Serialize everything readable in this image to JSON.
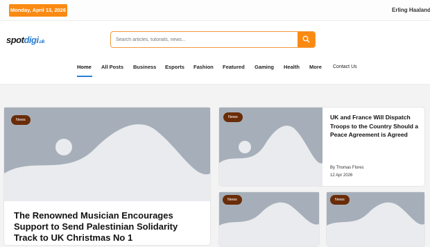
{
  "topbar": {
    "date": "Monday, April 13, 2026",
    "ticker": "Erling Haaland In"
  },
  "header": {
    "logo_part1": "spot",
    "logo_part2": "digi",
    "logo_part3": ".uk",
    "search_placeholder": "Search articles, tutorials, news...",
    "search_icon": "search-icon"
  },
  "nav": {
    "items": [
      "Home",
      "All Posts",
      "Business",
      "Esports",
      "Fashion",
      "Featured",
      "Gaming",
      "Health",
      "More",
      "Contact Us"
    ],
    "active": "Home"
  },
  "featured": {
    "tag": "News",
    "title": "The Renowned Musician Encourages Support to Send Palestinian Solidarity Track to UK Christmas No 1"
  },
  "side_article": {
    "tag": "News",
    "title": "UK and France Will Dispatch Troops to the Country Should a Peace Agreement is Agreed",
    "author": "By Thomas Flores",
    "date": "12 Apr 2026"
  },
  "small_cards": [
    {
      "tag": "News"
    },
    {
      "tag": "News"
    }
  ],
  "colors": {
    "accent": "#fb8a12",
    "brand_blue": "#2a7fd5",
    "tag_bg": "#6a2c08",
    "placeholder": "#a6afb9"
  }
}
